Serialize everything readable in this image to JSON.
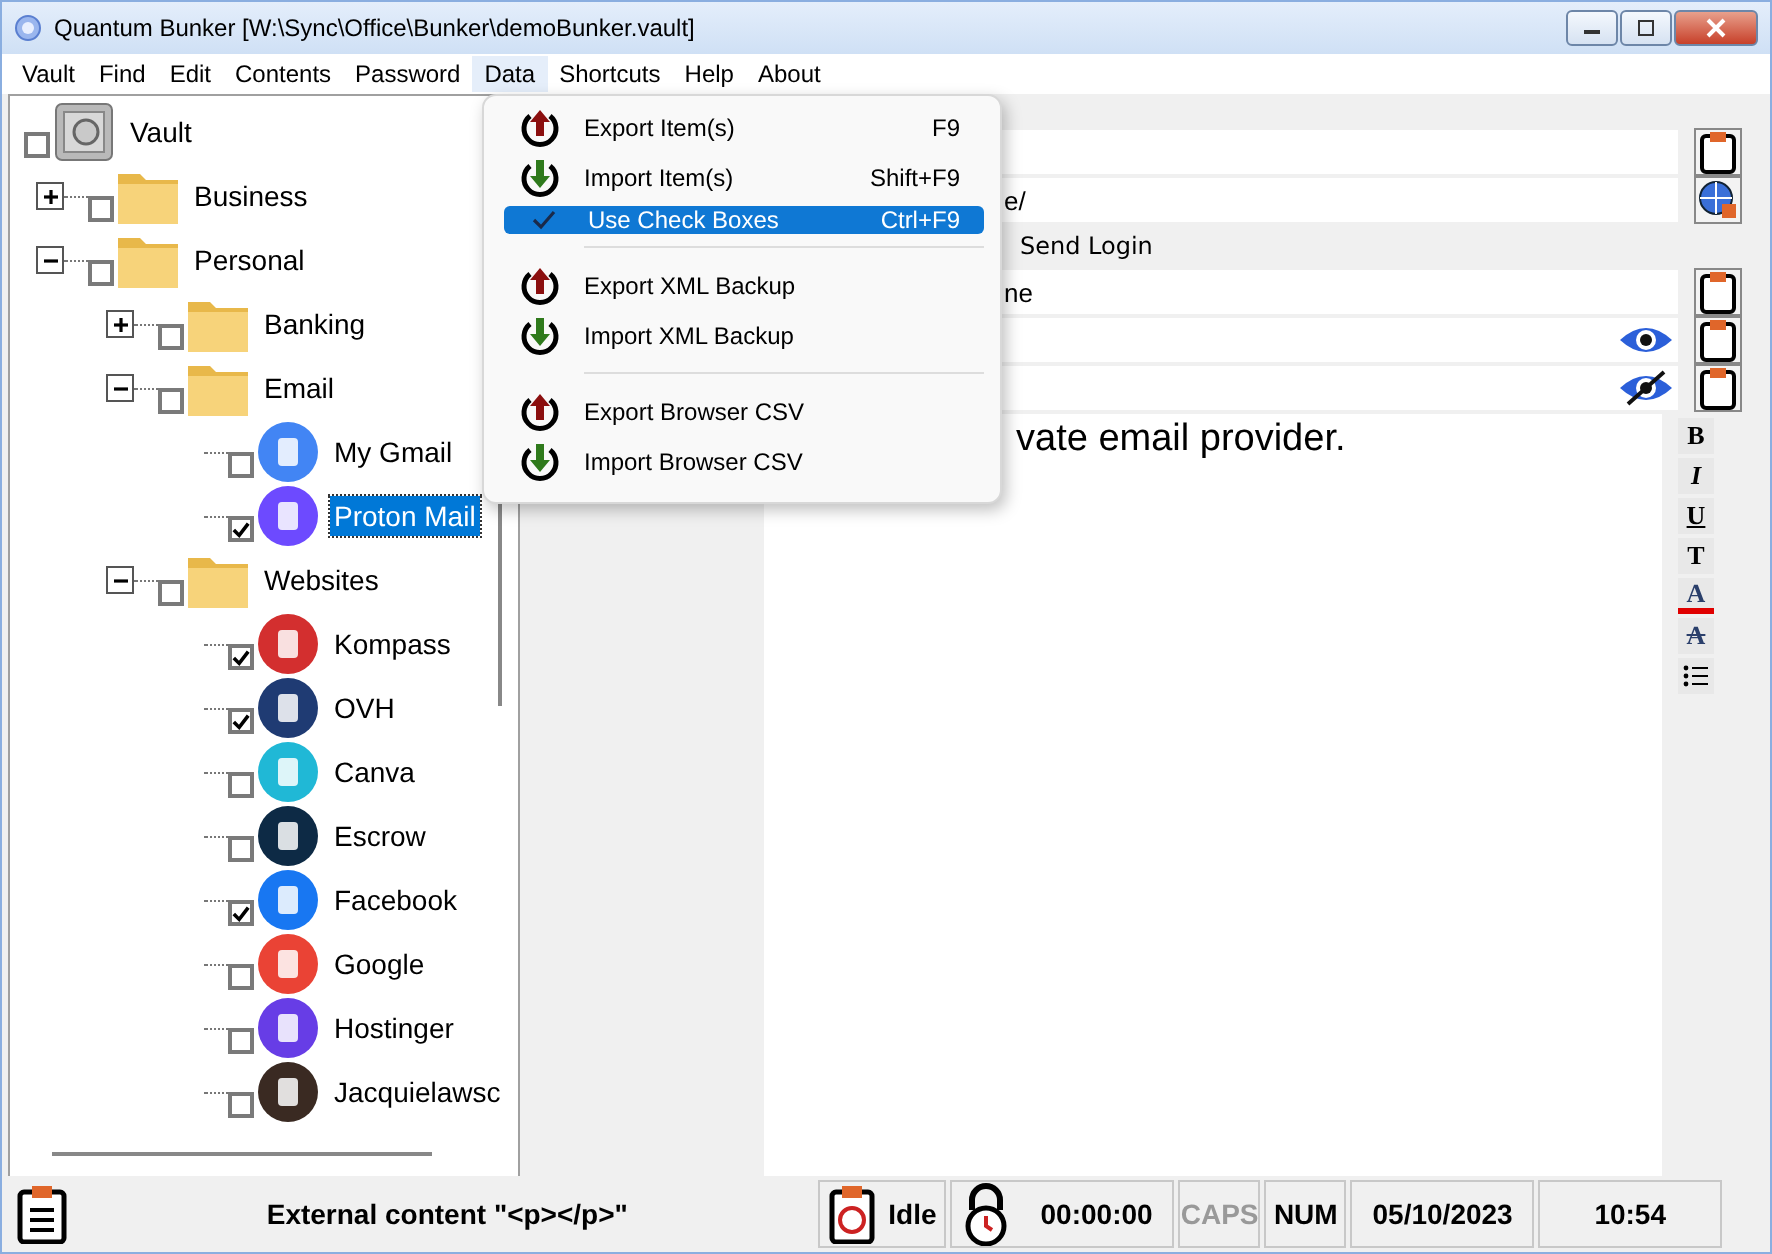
{
  "window": {
    "title": "Quantum Bunker [W:\\Sync\\Office\\Bunker\\demoBunker.vault]"
  },
  "menu_bar": [
    {
      "label": "Vault",
      "selected": false
    },
    {
      "label": "Find",
      "selected": false
    },
    {
      "label": "Edit",
      "selected": false
    },
    {
      "label": "Contents",
      "selected": false
    },
    {
      "label": "Password",
      "selected": false
    },
    {
      "label": "Data",
      "selected": true
    },
    {
      "label": "Shortcuts",
      "selected": false
    },
    {
      "label": "Help",
      "selected": false
    },
    {
      "label": "About",
      "selected": false
    }
  ],
  "data_menu": [
    {
      "kind": "export",
      "label": "Export Item(s)",
      "shortcut": "F9",
      "selected": false
    },
    {
      "kind": "import",
      "label": "Import Item(s)",
      "shortcut": "Shift+F9",
      "selected": false
    },
    {
      "kind": "option",
      "label": "Use Check Boxes",
      "shortcut": "Ctrl+F9",
      "checked": true,
      "selected": true
    },
    {
      "kind": "separator"
    },
    {
      "kind": "export",
      "label": "Export XML Backup",
      "selected": false
    },
    {
      "kind": "import",
      "label": "Import XML Backup",
      "selected": false
    },
    {
      "kind": "separator"
    },
    {
      "kind": "export",
      "label": "Export Browser CSV",
      "selected": false
    },
    {
      "kind": "import",
      "label": "Import Browser CSV",
      "selected": false
    }
  ],
  "tree": [
    {
      "kind": "vault",
      "label": "Vault",
      "checked": false,
      "selected": false,
      "children": [
        {
          "kind": "folder",
          "label": "Business",
          "checked": false,
          "selected": false,
          "expanded": false
        },
        {
          "kind": "folder",
          "label": "Personal",
          "checked": false,
          "selected": false,
          "expanded": true,
          "children": [
            {
              "kind": "folder",
              "label": "Banking",
              "checked": false,
              "selected": false,
              "expanded": false
            },
            {
              "kind": "folder",
              "label": "Email",
              "checked": false,
              "selected": false,
              "expanded": true,
              "children": [
                {
                  "kind": "entry",
                  "label": "My Gmail",
                  "color": "#4285f4",
                  "checked": false,
                  "selected": false
                },
                {
                  "kind": "entry",
                  "label": "Proton Mail",
                  "color": "#6d4aff",
                  "checked": true,
                  "selected": true
                }
              ]
            },
            {
              "kind": "folder",
              "label": "Websites",
              "checked": false,
              "selected": false,
              "expanded": true,
              "children": [
                {
                  "kind": "entry",
                  "label": "Kompass",
                  "color": "#d32f2f",
                  "checked": true,
                  "selected": false
                },
                {
                  "kind": "entry",
                  "label": "OVH",
                  "color": "#1f3b73",
                  "checked": true,
                  "selected": false
                },
                {
                  "kind": "entry",
                  "label": "Canva",
                  "color": "#20b8d6",
                  "checked": false,
                  "selected": false
                },
                {
                  "kind": "entry",
                  "label": "Escrow",
                  "color": "#0d2a45",
                  "checked": false,
                  "selected": false
                },
                {
                  "kind": "entry",
                  "label": "Facebook",
                  "color": "#1877f2",
                  "checked": true,
                  "selected": false
                },
                {
                  "kind": "entry",
                  "label": "Google",
                  "color": "#ea4335",
                  "checked": false,
                  "selected": false
                },
                {
                  "kind": "entry",
                  "label": "Hostinger",
                  "color": "#673de6",
                  "checked": false,
                  "selected": false
                },
                {
                  "kind": "entry",
                  "label": "Jacquielawsc",
                  "color": "#3a2a22",
                  "checked": false,
                  "selected": false
                }
              ]
            }
          ]
        }
      ]
    }
  ],
  "fields": [
    {
      "kind": "text"
    },
    {
      "kind": "url",
      "value": "e/"
    },
    {
      "kind": "label",
      "value": "Send Login"
    },
    {
      "kind": "text",
      "value": "ne"
    },
    {
      "kind": "password",
      "revealed": true
    },
    {
      "kind": "password",
      "revealed": false
    }
  ],
  "notes": {
    "text": "vate email provider."
  },
  "format_tools": [
    {
      "kind": "bold",
      "label": "B"
    },
    {
      "kind": "italic",
      "label": "I"
    },
    {
      "kind": "underline",
      "label": "U"
    },
    {
      "kind": "font",
      "label": "T"
    },
    {
      "kind": "color",
      "label": "A"
    },
    {
      "kind": "strike",
      "label": "A"
    },
    {
      "kind": "list"
    }
  ],
  "status_bar": {
    "message": "External content \"<p></p>\"",
    "state": "Idle",
    "timer": "00:00:00",
    "indicators": [
      {
        "label": "CAPS",
        "on": false
      },
      {
        "label": "NUM",
        "on": true
      }
    ],
    "date": "05/10/2023",
    "time": "10:54"
  }
}
